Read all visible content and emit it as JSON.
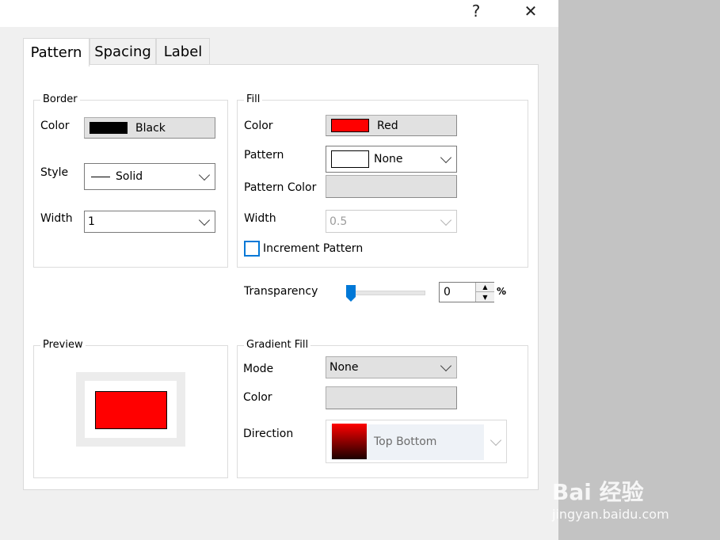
{
  "titlebar": {
    "help_label": "?",
    "close_label": "✕"
  },
  "tabs": [
    {
      "label": "Pattern"
    },
    {
      "label": "Spacing"
    },
    {
      "label": "Label"
    }
  ],
  "border": {
    "title": "Border",
    "color_label": "Color",
    "color_value": "Black",
    "color_hex": "#000000",
    "style_label": "Style",
    "style_value": "Solid",
    "width_label": "Width",
    "width_value": "1"
  },
  "fill": {
    "title": "Fill",
    "color_label": "Color",
    "color_value": "Red",
    "color_hex": "#ff0000",
    "pattern_label": "Pattern",
    "pattern_value": "None",
    "pattern_color_label": "Pattern Color",
    "width_label": "Width",
    "width_value": "0.5",
    "increment_label": "Increment Pattern",
    "increment_checked": false
  },
  "transparency": {
    "label": "Transparency",
    "value": "0",
    "unit": "%",
    "slider_fraction": 0.0
  },
  "preview": {
    "title": "Preview",
    "fill_hex": "#ff0000"
  },
  "gradient": {
    "title": "Gradient Fill",
    "mode_label": "Mode",
    "mode_value": "None",
    "color_label": "Color",
    "direction_label": "Direction",
    "direction_value": "Top Bottom"
  },
  "watermark": {
    "brand": "Bai 经验",
    "url": "jingyan.baidu.com"
  }
}
